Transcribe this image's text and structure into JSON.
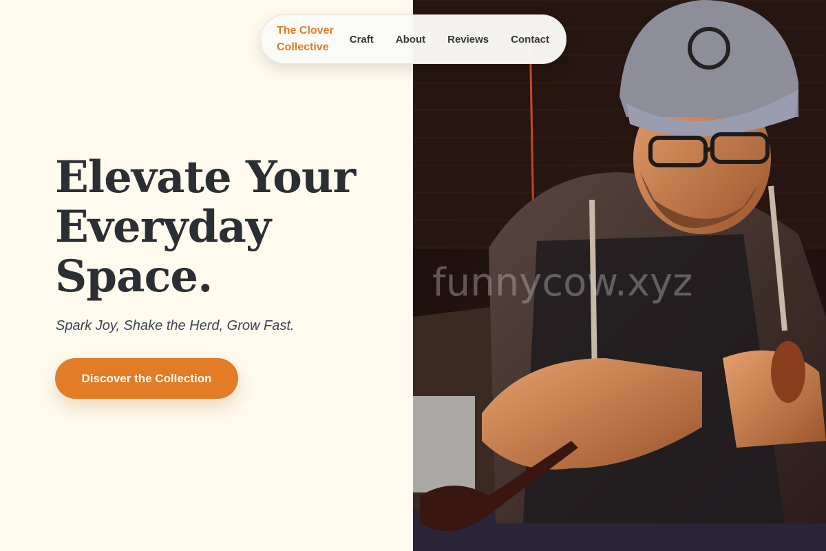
{
  "nav": {
    "brand_line1": "The Clover",
    "brand_line2": "Collective",
    "links": [
      "Craft",
      "About",
      "Reviews",
      "Contact"
    ]
  },
  "hero": {
    "title_lines": [
      "Elevate Your",
      "Everyday",
      "Space."
    ],
    "subtitle": "Spark Joy, Shake the Herd, Grow Fast.",
    "cta_label": "Discover the Collection"
  },
  "watermark": "funnycow.xyz",
  "colors": {
    "accent": "#e07b26",
    "background": "#fefaee",
    "text_dark": "#2b2f33"
  }
}
